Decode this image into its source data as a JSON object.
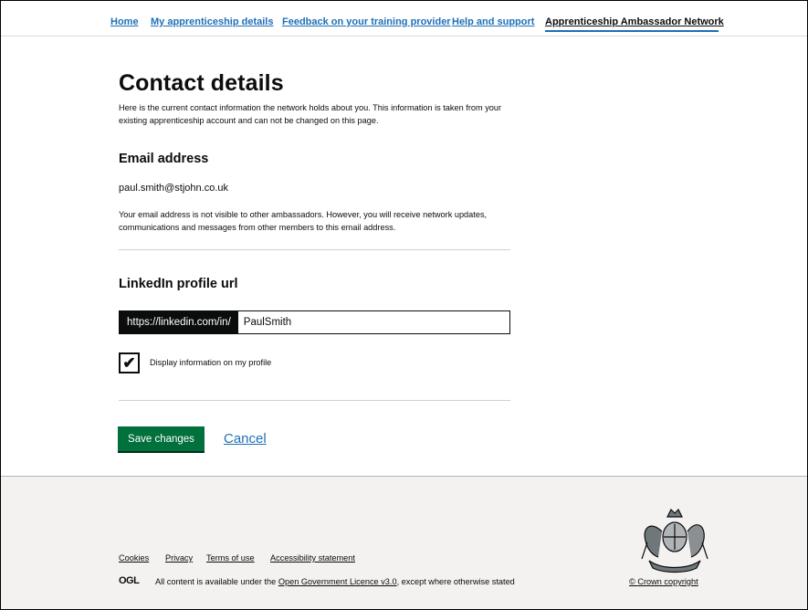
{
  "nav": {
    "items": [
      {
        "label": "Home"
      },
      {
        "label": "My apprenticeship details"
      },
      {
        "label": "Feedback on your training provider"
      },
      {
        "label": "Help and support"
      },
      {
        "label": "Apprenticeship Ambassador Network"
      }
    ],
    "active_index": 4,
    "accent_color": "#1d70b8"
  },
  "page": {
    "title": "Contact details",
    "intro": "Here is the current contact information the network holds about you. This information is taken from your existing apprenticeship account and can not be changed on this page."
  },
  "email": {
    "heading": "Email address",
    "value": "paul.smith@stjohn.co.uk",
    "note": "Your email address is not visible to other ambassadors. However, you will receive network updates, communications and messages from other members to this email address."
  },
  "linkedin": {
    "heading": "LinkedIn profile url",
    "prefix": "https://linkedin.com/in/",
    "value": "PaulSmith",
    "checkbox_label": "Display information on my profile",
    "checkbox_checked": true
  },
  "actions": {
    "save_label": "Save changes",
    "cancel_label": "Cancel",
    "save_color": "#00703c"
  },
  "footer": {
    "links": [
      "Cookies",
      "Privacy",
      "Terms of use",
      "Accessibility statement"
    ],
    "ogl_logo": "OGL",
    "licence_prefix": "All content is available under the ",
    "licence_link": "Open Government Licence v3.0",
    "licence_suffix": ", except where otherwise stated",
    "copyright": "© Crown copyright",
    "crest_icon": "royal-coat-of-arms-icon"
  }
}
